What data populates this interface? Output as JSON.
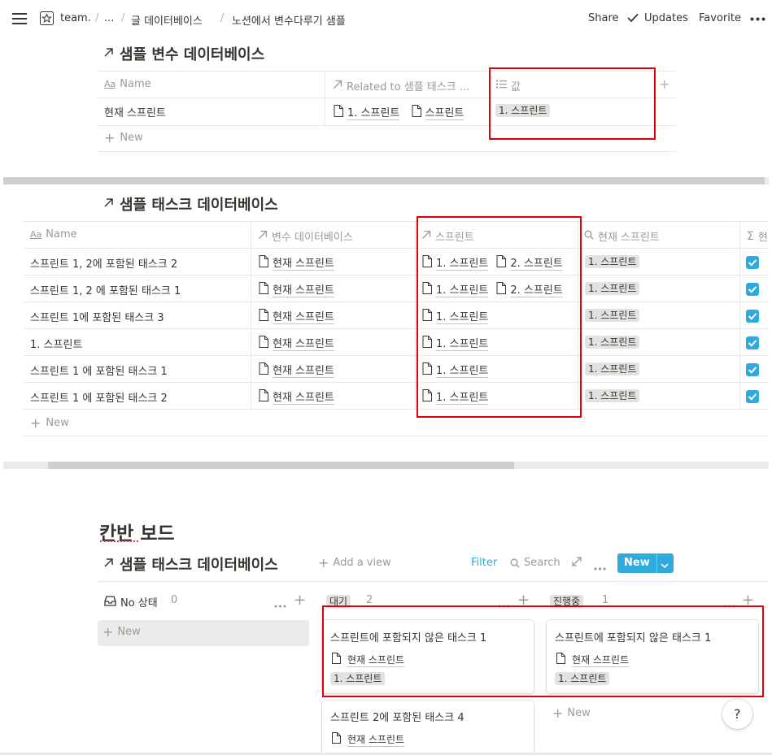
{
  "topbar": {
    "breadcrumbs": [
      "team.",
      "...",
      "글 데이터베이스",
      "노션에서 변수다루기 샘플"
    ],
    "share": "Share",
    "updates": "Updates",
    "favorite": "Favorite"
  },
  "var_db": {
    "title": "샘플 변수 데이터베이스",
    "columns": [
      "Name",
      "Related to 샘플 태스크 ...",
      "값"
    ],
    "row": {
      "name": "현재 스프린트",
      "related": [
        "1. 스프린트",
        "스프린트 "
      ],
      "value": "1. 스프린트"
    },
    "new_label": "New"
  },
  "task_db": {
    "title": "샘플 태스크 데이터베이스",
    "columns": [
      "Name",
      "변수 데이터베이스",
      "스프린트",
      "현재 스프린트",
      "현"
    ],
    "rows": [
      {
        "name": "스프린트 1, 2에 포함된 태스크 2",
        "var": "현재 스프린트",
        "sprints": [
          "1. 스프린트",
          "2. 스프린트"
        ],
        "current": "1. 스프린트"
      },
      {
        "name": "스프린트 1, 2 에 포함된 태스크 1",
        "var": "현재 스프린트",
        "sprints": [
          "1. 스프린트",
          "2. 스프린트"
        ],
        "current": "1. 스프린트"
      },
      {
        "name": "스프린트 1에 포함된 태스크 3",
        "var": "현재 스프린트",
        "sprints": [
          "1. 스프린트"
        ],
        "current": "1. 스프린트"
      },
      {
        "name": "1. 스프린트",
        "var": "현재 스프린트",
        "sprints": [
          "1. 스프린트"
        ],
        "current": "1. 스프린트"
      },
      {
        "name": "스프린트 1 에 포함된 태스크 1",
        "var": "현재 스프린트",
        "sprints": [
          "1. 스프린트"
        ],
        "current": "1. 스프린트"
      },
      {
        "name": "스프린트 1 에 포함된 태스크 2",
        "var": "현재 스프린트",
        "sprints": [
          "1. 스프린트"
        ],
        "current": "1. 스프린트"
      }
    ],
    "new_label": "New"
  },
  "kanban": {
    "heading": "칸반 보드",
    "db_title": "샘플 태스크 데이터베이스",
    "add_view": "Add a view",
    "filter": "Filter",
    "search": "Search",
    "new_button": "New",
    "groups": [
      {
        "label": "No 상태",
        "count": "0"
      },
      {
        "label": "대기",
        "count": "2"
      },
      {
        "label": "진행중",
        "count": "1"
      }
    ],
    "new_label": "New",
    "cards": [
      {
        "title": "스프린트에 포함되지 않은 태스크 1",
        "var": "현재 스프린트",
        "sprint": "1. 스프린트"
      },
      {
        "title": "스프린트에 포함되지 않은 태스크 1",
        "var": "현재 스프린트",
        "sprint": "1. 스프린트"
      },
      {
        "title": "스프린트 2에 포함된 태스크 4",
        "var": "현재 스프린트"
      }
    ],
    "help": "?"
  }
}
